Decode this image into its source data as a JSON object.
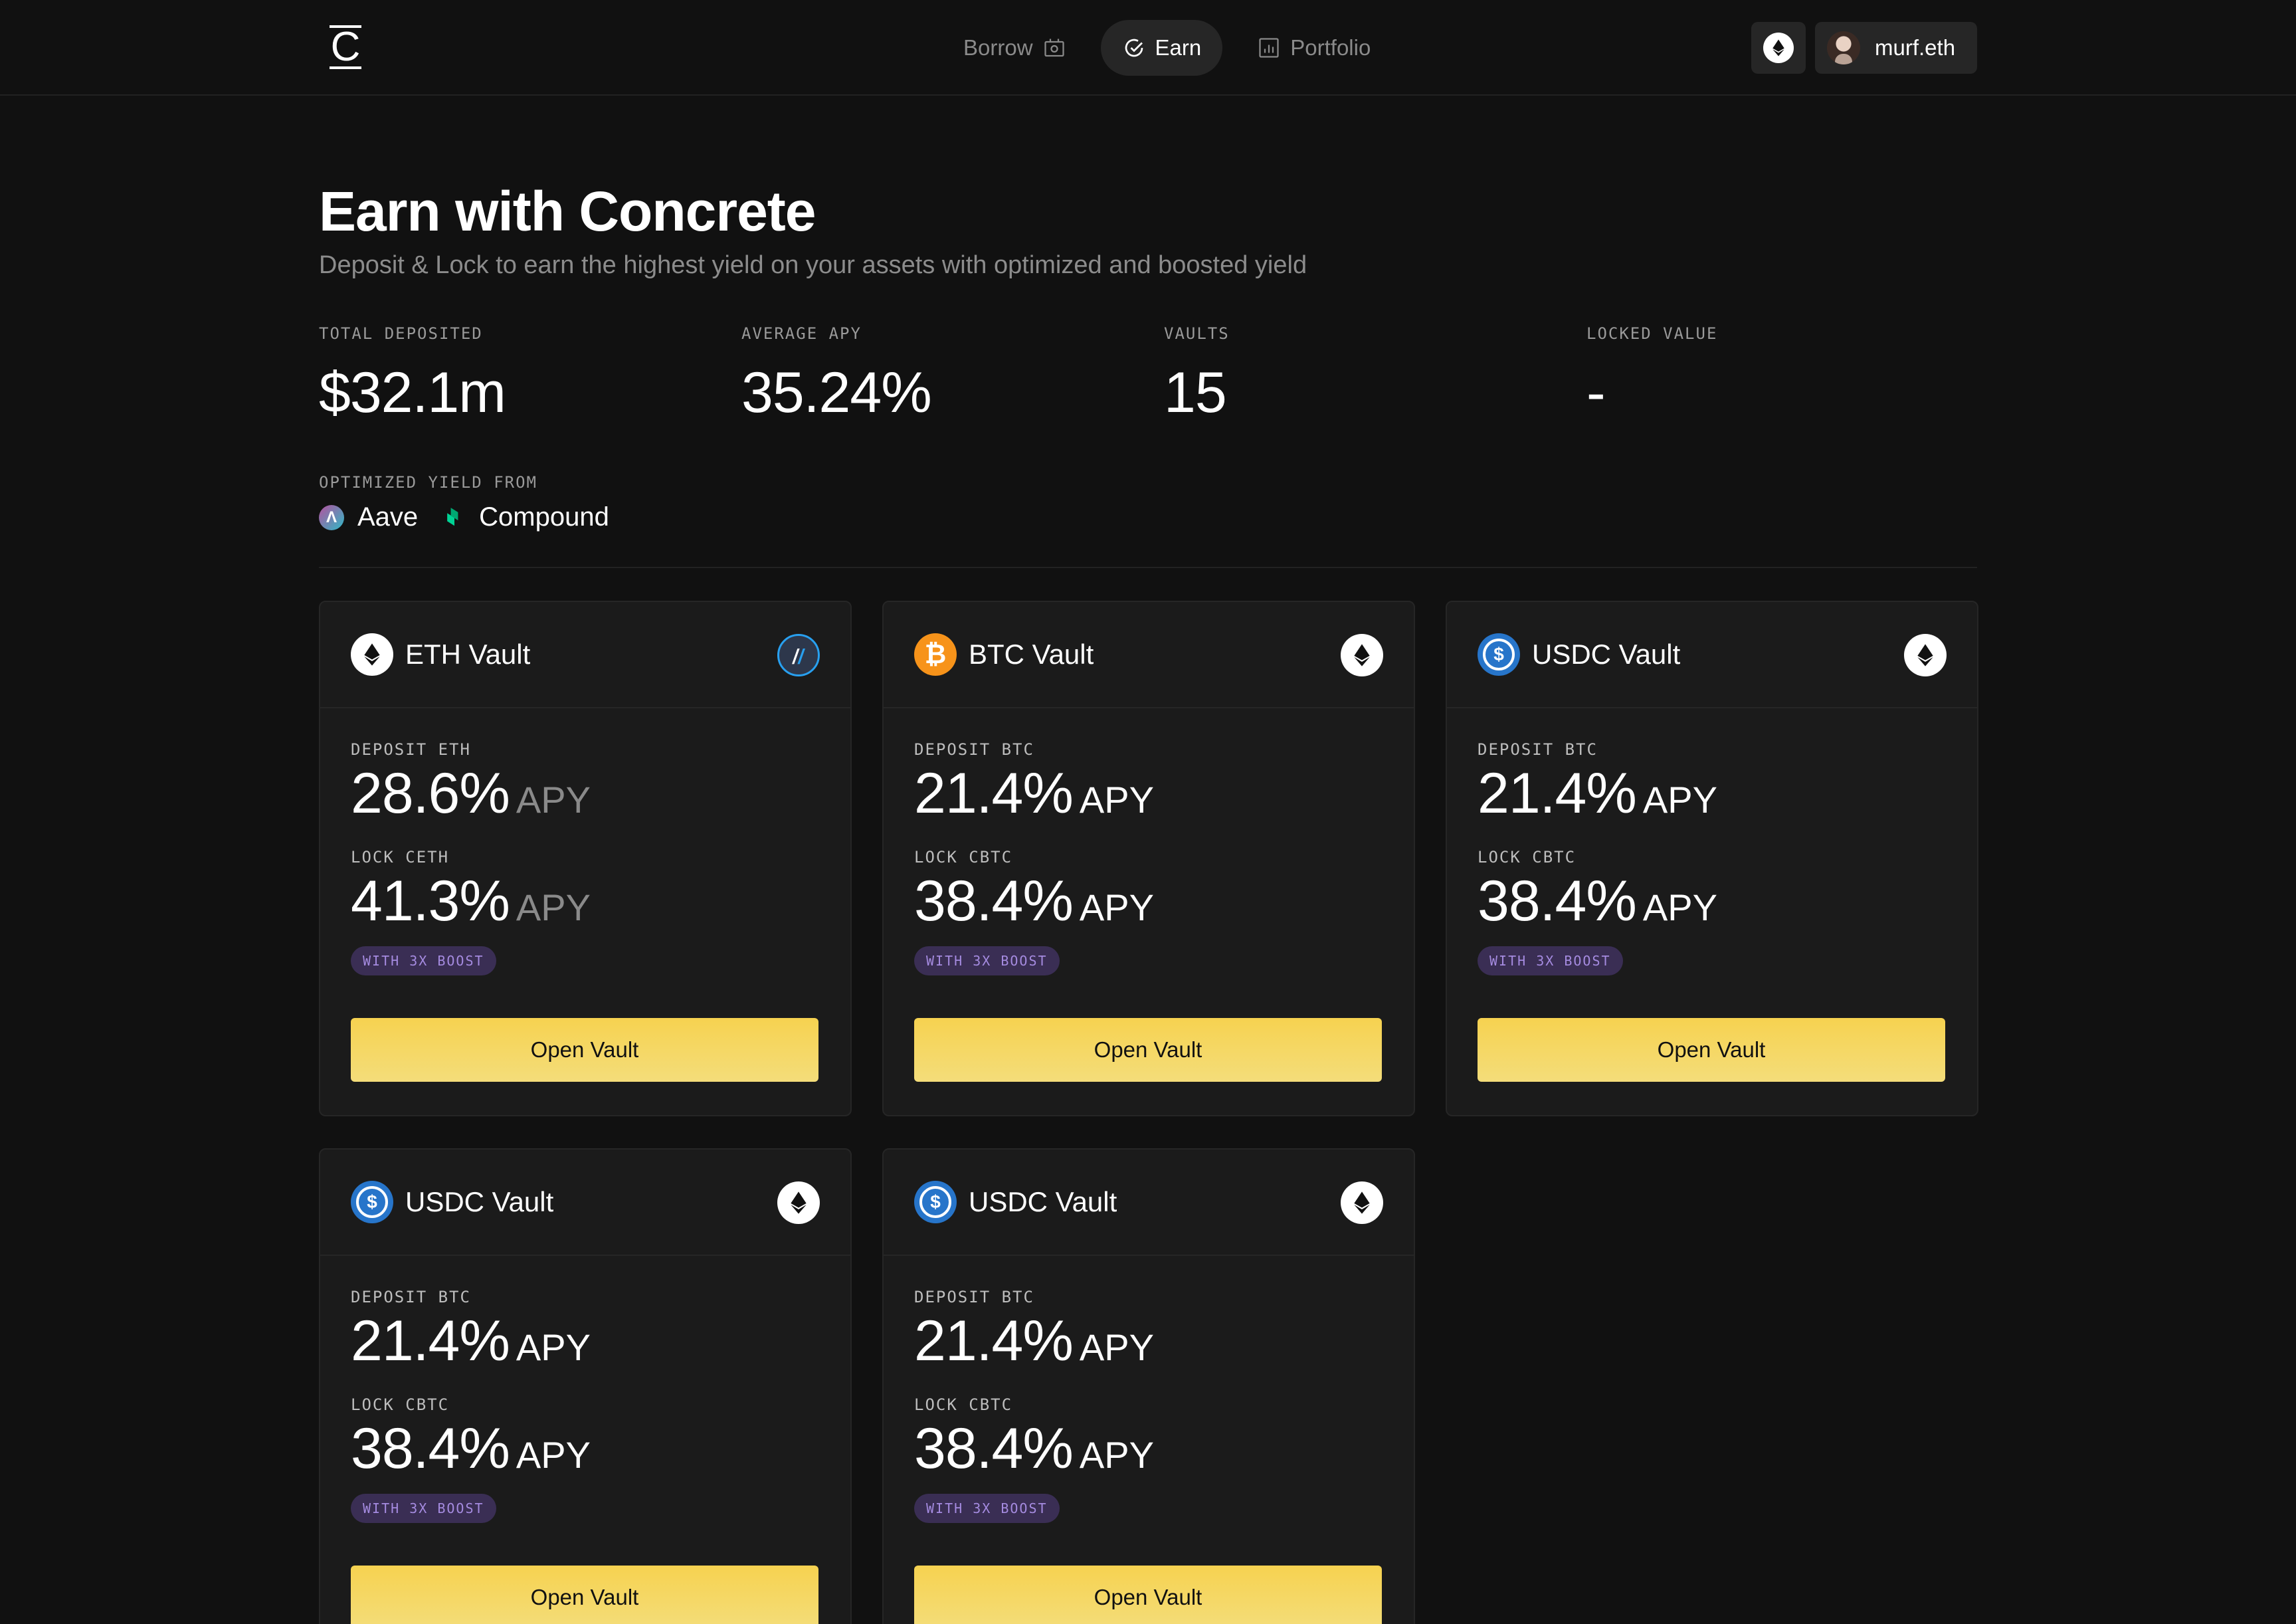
{
  "nav": {
    "logo": "C",
    "links": [
      {
        "label": "Borrow",
        "icon": "borrow-icon"
      },
      {
        "label": "Earn",
        "icon": "earn-icon",
        "active": true
      },
      {
        "label": "Portfolio",
        "icon": "portfolio-icon"
      }
    ],
    "network_icon": "ethereum-icon",
    "username": "murf.eth"
  },
  "header": {
    "title": "Earn with Concrete",
    "subtitle": "Deposit & Lock to earn the highest yield on your assets with optimized and boosted yield"
  },
  "stats": [
    {
      "label": "TOTAL DEPOSITED",
      "value": "$32.1m"
    },
    {
      "label": "AVERAGE APY",
      "value": "35.24%"
    },
    {
      "label": "VAULTS",
      "value": "15"
    },
    {
      "label": "LOCKED VALUE",
      "value": "-"
    }
  ],
  "yield": {
    "label": "OPTIMIZED YIELD FROM",
    "providers": [
      {
        "name": "Aave",
        "icon": "aave-icon"
      },
      {
        "name": "Compound",
        "icon": "compound-icon"
      }
    ]
  },
  "vaults": [
    {
      "name": "ETH Vault",
      "coin": "eth",
      "chain": "arbitrum",
      "deposit_label": "DEPOSIT ETH",
      "deposit_rate": "28.6%",
      "lock_label": "LOCK CETH",
      "lock_rate": "41.3%",
      "apy": "APY",
      "boost": "WITH 3X BOOST",
      "button": "Open Vault"
    },
    {
      "name": "BTC Vault",
      "coin": "btc",
      "chain": "ethereum",
      "deposit_label": "DEPOSIT BTC",
      "deposit_rate": "21.4%",
      "lock_label": "LOCK CBTC",
      "lock_rate": "38.4%",
      "apy": "APY",
      "boost": "WITH 3X BOOST",
      "button": "Open Vault"
    },
    {
      "name": "USDC Vault",
      "coin": "usdc",
      "chain": "ethereum",
      "deposit_label": "DEPOSIT BTC",
      "deposit_rate": "21.4%",
      "lock_label": "LOCK CBTC",
      "lock_rate": "38.4%",
      "apy": "APY",
      "boost": "WITH 3X BOOST",
      "button": "Open Vault"
    },
    {
      "name": "USDC Vault",
      "coin": "usdc",
      "chain": "ethereum",
      "deposit_label": "DEPOSIT BTC",
      "deposit_rate": "21.4%",
      "lock_label": "LOCK CBTC",
      "lock_rate": "38.4%",
      "apy": "APY",
      "boost": "WITH 3X BOOST",
      "button": "Open Vault"
    },
    {
      "name": "USDC Vault",
      "coin": "usdc",
      "chain": "ethereum",
      "deposit_label": "DEPOSIT BTC",
      "deposit_rate": "21.4%",
      "lock_label": "LOCK CBTC",
      "lock_rate": "38.4%",
      "apy": "APY",
      "boost": "WITH 3X BOOST",
      "button": "Open Vault"
    }
  ],
  "colors": {
    "background": "#111111",
    "card": "#1b1b1b",
    "accent_button": "#f6d250",
    "boost_bg": "#3a2e54",
    "boost_text": "#a58be0"
  }
}
